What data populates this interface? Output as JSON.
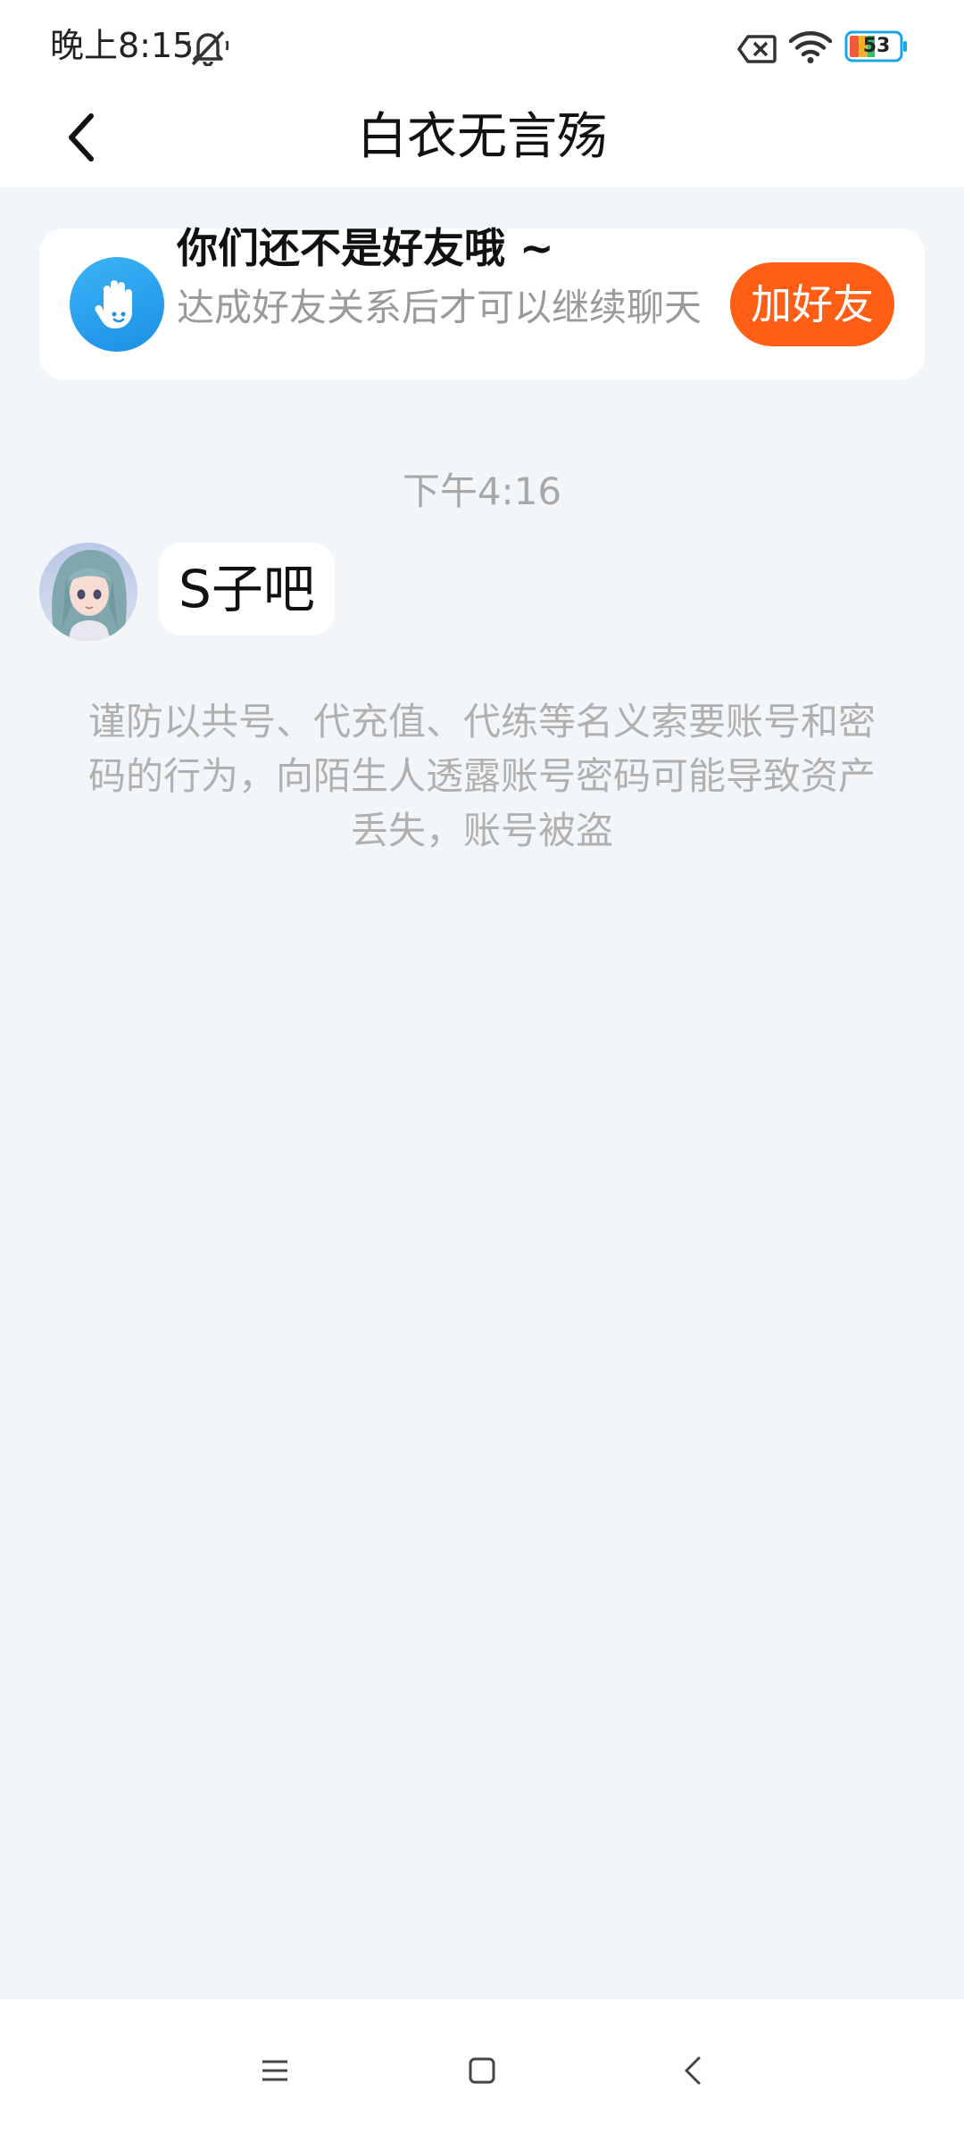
{
  "status_bar": {
    "time": "晚上8:15",
    "battery_level": "53",
    "icons": [
      "mute-icon",
      "sim-blocked-icon",
      "wifi-icon",
      "battery-icon"
    ]
  },
  "header": {
    "title": "白衣无言殇",
    "back_icon": "chevron-left-icon"
  },
  "friend_notice": {
    "title": "你们还不是好友哦 ~",
    "description": "达成好友关系后才可以继续聊天",
    "button_label": "加好友",
    "icon": "waving-hand-icon",
    "button_color": "#ff5e14"
  },
  "chat": {
    "timestamp": "下午4:16",
    "messages": [
      {
        "sender": "白衣无言殇",
        "text": "S子吧",
        "avatar": "anime-avatar"
      }
    ]
  },
  "safety_notice": "谨防以共号、代充值、代练等名义索要账号和密码的行为，向陌生人透露账号密码可能导致资产丢失，账号被盗",
  "nav_bar": {
    "icons": [
      "menu-icon",
      "home-icon",
      "back-icon"
    ]
  },
  "colors": {
    "background": "#f3f6f9",
    "accent": "#ff5e14",
    "icon_blue": "#1d8fe6"
  }
}
